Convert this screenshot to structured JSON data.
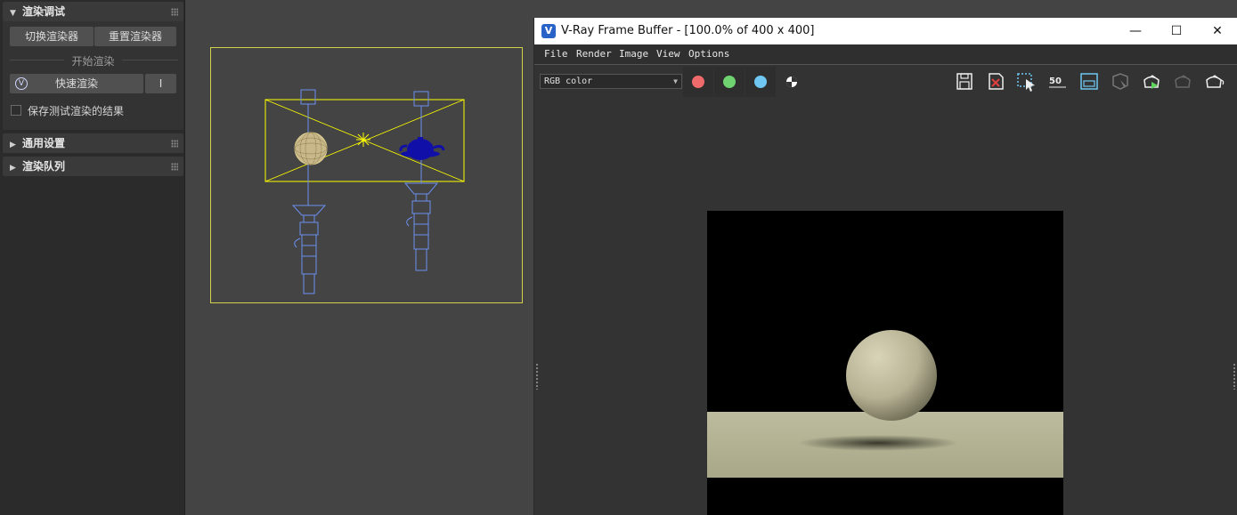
{
  "left_panel": {
    "render_debug": {
      "title": "渲染调试",
      "switch_renderer": "切换渲染器",
      "reset_renderer": "重置渲染器",
      "start_render_label": "开始渲染",
      "quick_render": "快速渲染",
      "quick_render_extra": "I",
      "save_results_label": "保存测试渲染的结果",
      "save_results_checked": false
    },
    "general_settings": {
      "title": "通用设置"
    },
    "render_queue": {
      "title": "渲染队列"
    }
  },
  "vfb": {
    "title": "V-Ray Frame Buffer - [100.0% of 400 x 400]",
    "menu": [
      "File",
      "Render",
      "Image",
      "View",
      "Options"
    ],
    "channel": "RGB color",
    "channel_buttons": [
      {
        "name": "red-channel",
        "color": "#ef6a6a"
      },
      {
        "name": "green-channel",
        "color": "#6fd36f"
      },
      {
        "name": "blue-channel",
        "color": "#6fc7f2"
      },
      {
        "name": "alpha-channel",
        "color": "#ffffff"
      }
    ],
    "toolbar_icons": [
      "save-icon",
      "clear-image-icon",
      "region-render-icon",
      "zoom-50-icon",
      "frame-icon",
      "track-mouse-icon",
      "render-icon",
      "stop-render-icon",
      "render-last-icon"
    ],
    "zoom_badge": "50"
  },
  "colors": {
    "accent": "#2a63c8",
    "viewport_frame": "#d2d24a",
    "selection": "#ffff00",
    "light_wire": "#6a8ff0"
  }
}
